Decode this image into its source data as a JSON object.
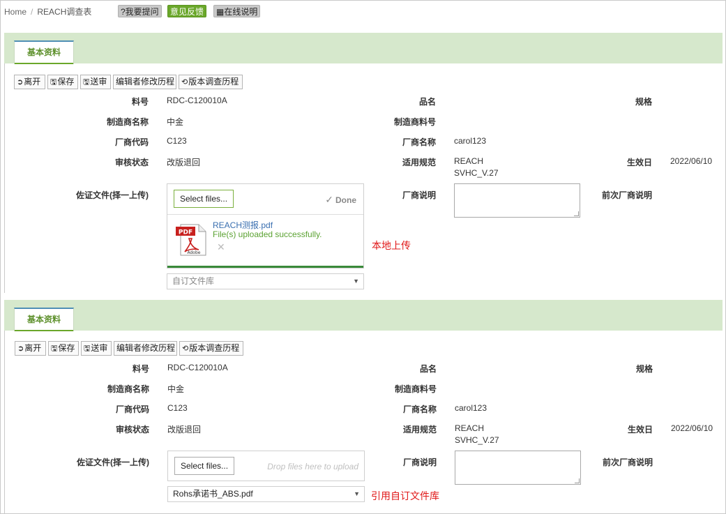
{
  "breadcrumb": {
    "home": "Home",
    "current": "REACH调查表"
  },
  "top_buttons": {
    "ask": "?我要提问",
    "feedback": "意见反馈",
    "help": "在线说明"
  },
  "sections": [
    {
      "tab": "基本资料",
      "actions": {
        "leave": "离开",
        "save": "保存",
        "submit": "送审",
        "editor_history": "编辑者修改历程",
        "version_history": "版本调查历程"
      },
      "fields": {
        "part_no_label": "料号",
        "part_no": "RDC-C120010A",
        "name_label": "品名",
        "spec_label": "规格",
        "mfr_name_label": "制造商名称",
        "mfr_name": "中金",
        "mfr_part_label": "制造商料号",
        "vendor_code_label": "厂商代码",
        "vendor_code": "C123",
        "vendor_name_label": "厂商名称",
        "vendor_name": "carol123",
        "review_status_label": "审核状态",
        "review_status": "改版退回",
        "regulation_label": "适用规范",
        "regulation_line1": "REACH",
        "regulation_line2": "SVHC_V.27",
        "effective_label": "生效日",
        "effective_date": "2022/06/10",
        "evidence_label": "佐证文件(择一上传)",
        "vendor_note_label": "厂商说明",
        "prev_note_label": "前次厂商说明"
      },
      "upload": {
        "select_label": "Select files...",
        "done_label": "Done",
        "file_name": "REACH测报.pdf",
        "file_status": "File(s) uploaded successfully.",
        "library_placeholder": "自订文件库"
      },
      "annotation": "本地上传"
    },
    {
      "tab": "基本资料",
      "actions": {
        "leave": "离开",
        "save": "保存",
        "submit": "送审",
        "editor_history": "编辑者修改历程",
        "version_history": "版本调查历程"
      },
      "fields": {
        "part_no_label": "料号",
        "part_no": "RDC-C120010A",
        "name_label": "品名",
        "spec_label": "规格",
        "mfr_name_label": "制造商名称",
        "mfr_name": "中金",
        "mfr_part_label": "制造商料号",
        "vendor_code_label": "厂商代码",
        "vendor_code": "C123",
        "vendor_name_label": "厂商名称",
        "vendor_name": "carol123",
        "review_status_label": "审核状态",
        "review_status": "改版退回",
        "regulation_label": "适用规范",
        "regulation_line1": "REACH",
        "regulation_line2": "SVHC_V.27",
        "effective_label": "生效日",
        "effective_date": "2022/06/10",
        "evidence_label": "佐证文件(择一上传)",
        "vendor_note_label": "厂商说明",
        "prev_note_label": "前次厂商说明"
      },
      "upload": {
        "select_label": "Select files...",
        "drop_hint": "Drop files here to upload",
        "library_value": "Rohs承诺书_ABS.pdf"
      },
      "annotation": "引用自订文件库"
    }
  ],
  "pdf_icon_text": {
    "pdf": "PDF",
    "adobe": "Adobe"
  },
  "colors": {
    "tab_band": "#d6e8cc",
    "accent_green": "#6aa72a",
    "annotation_red": "#e01818",
    "link_blue": "#3a6fb0"
  }
}
